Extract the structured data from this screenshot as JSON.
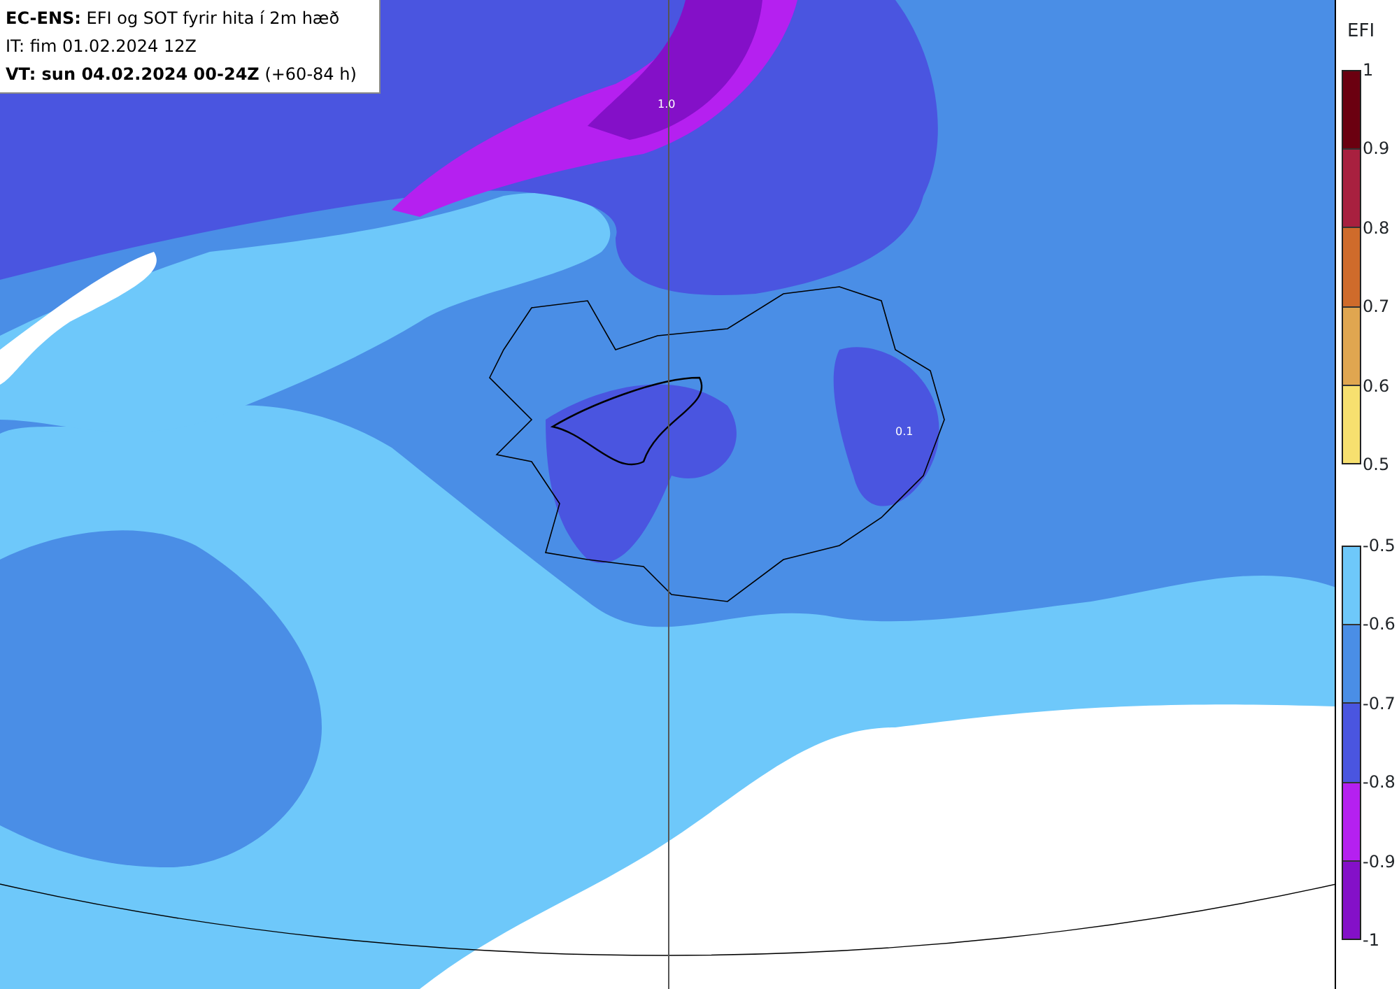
{
  "header": {
    "lines": [
      {
        "text": "**EC-ENS:** EFI og SOT fyrir hita í 2m hæð"
      },
      {
        "text": "IT: fim 01.02.2024 12Z"
      },
      {
        "text": "**VT: sun 04.02.2024 00-24Z** (+60-84 h)"
      }
    ]
  },
  "map": {
    "contour_labels": [
      {
        "text": "1.0"
      },
      {
        "text": "0.1"
      }
    ]
  },
  "legend": {
    "title": "EFI",
    "scales": [
      {
        "ticks": [
          "1",
          "0.9",
          "0.8",
          "0.7",
          "0.6",
          "0.5"
        ],
        "bins": [
          {
            "color": "#6b0010"
          },
          {
            "color": "#a8203f"
          },
          {
            "color": "#cf6b2b"
          },
          {
            "color": "#e0a650"
          },
          {
            "color": "#f7e06f"
          }
        ]
      },
      {
        "ticks": [
          "-0.5",
          "-0.6",
          "-0.7",
          "-0.8",
          "-0.9",
          "-1"
        ],
        "bins": [
          {
            "color": "#6ec8fa"
          },
          {
            "color": "#4a8ee6"
          },
          {
            "color": "#4a55e0"
          },
          {
            "color": "#b520f0"
          },
          {
            "color": "#8410c8"
          }
        ]
      }
    ]
  }
}
